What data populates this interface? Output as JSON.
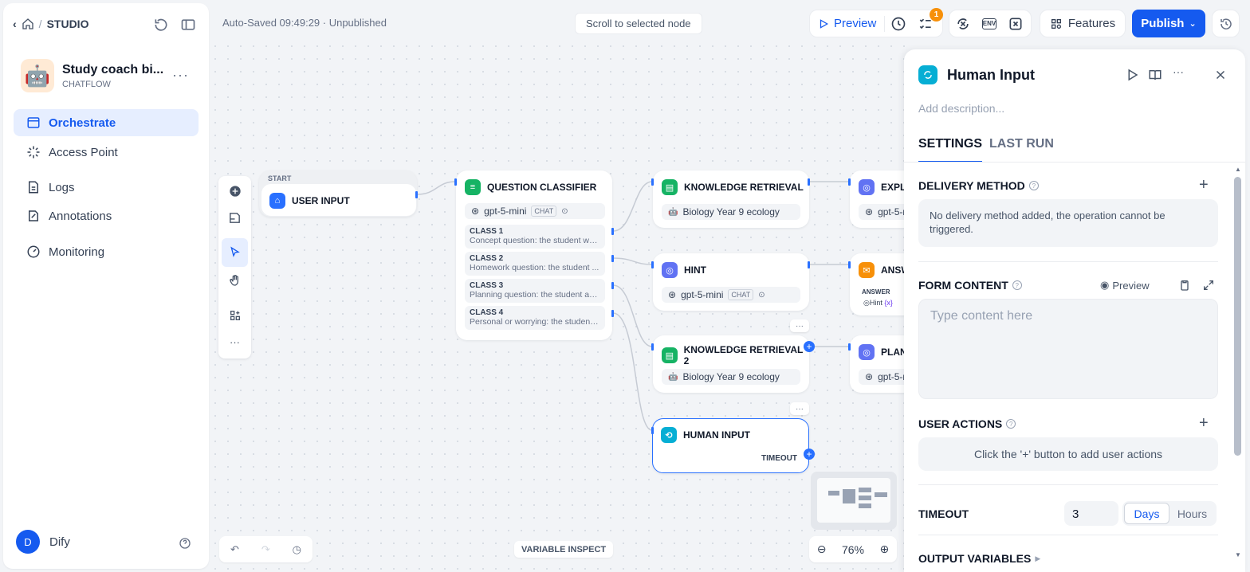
{
  "sidebar": {
    "breadcrumb": "STUDIO",
    "app": {
      "name": "Study coach bi...",
      "type": "CHATFLOW",
      "icon": "🤖"
    },
    "nav": [
      {
        "label": "Orchestrate"
      },
      {
        "label": "Access Point"
      },
      {
        "label": "Logs"
      },
      {
        "label": "Annotations"
      },
      {
        "label": "Monitoring"
      }
    ],
    "user": {
      "initial": "D",
      "name": "Dify"
    }
  },
  "topbar": {
    "autosave": "Auto-Saved 09:49:29 · Unpublished",
    "scroll_label": "Scroll to selected node",
    "preview_label": "Preview",
    "checklist_count": "1",
    "features_label": "Features",
    "publish_label": "Publish",
    "env_label": "ENV"
  },
  "canvas": {
    "start_label": "START",
    "nodes": {
      "user_input": "USER INPUT",
      "classifier": {
        "title": "QUESTION CLASSIFIER",
        "model": "gpt-5-mini",
        "mode": "CHAT",
        "classes": [
          {
            "name": "CLASS 1",
            "desc": "Concept question: the student wa..."
          },
          {
            "name": "CLASS 2",
            "desc": "Homework question: the student ..."
          },
          {
            "name": "CLASS 3",
            "desc": "Planning question: the student as..."
          },
          {
            "name": "CLASS 4",
            "desc": "Personal or worrying: the student ..."
          }
        ]
      },
      "kr1": {
        "title": "KNOWLEDGE RETRIEVAL",
        "dataset": "Biology Year 9 ecology"
      },
      "hint": {
        "title": "HINT",
        "model": "gpt-5-mini",
        "mode": "CHAT"
      },
      "kr2": {
        "title": "KNOWLEDGE RETRIEVAL 2",
        "dataset": "Biology Year 9 ecology"
      },
      "human": {
        "title": "HUMAN INPUT",
        "timeout": "TIMEOUT"
      },
      "explain": {
        "title": "EXPLA",
        "model": "gpt-5-m"
      },
      "answer": {
        "title": "ANSW",
        "sub": "ANSWER",
        "var": "Hint"
      },
      "plan": {
        "title": "PLANN",
        "model": "gpt-5-m"
      }
    },
    "zoom": "76%",
    "variable_inspect": "VARIABLE INSPECT"
  },
  "panel": {
    "title": "Human Input",
    "description_placeholder": "Add description...",
    "tabs": [
      "SETTINGS",
      "LAST RUN"
    ],
    "delivery": {
      "title": "DELIVERY METHOD",
      "empty": "No delivery method added, the operation cannot be triggered."
    },
    "form": {
      "title": "FORM CONTENT",
      "preview": "Preview",
      "placeholder": "Type content here"
    },
    "actions": {
      "title": "USER ACTIONS",
      "empty": "Click the '+' button to add user actions"
    },
    "timeout": {
      "title": "TIMEOUT",
      "value": "3",
      "units": [
        "Days",
        "Hours"
      ]
    },
    "output": {
      "title": "OUTPUT VARIABLES"
    }
  },
  "colors": {
    "accent": "#155aef",
    "selection": "#2970ff",
    "badge": "#f79009"
  }
}
